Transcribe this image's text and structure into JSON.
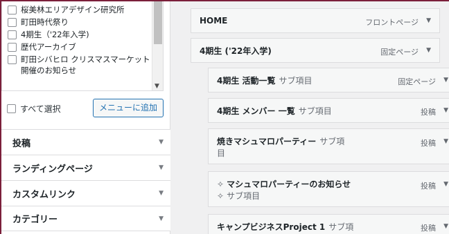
{
  "page_checklist": {
    "items": [
      "桜美林エリアデザイン研究所",
      "町田時代祭り",
      "4期生（'22年入学)",
      "歴代アーカイブ",
      "町田シバヒロ クリスマスマーケット開催のお知らせ"
    ],
    "select_all": "すべて選択",
    "add_to_menu": "メニューに追加"
  },
  "accordions": [
    "投稿",
    "ランディングページ",
    "カスタムリンク",
    "カテゴリー"
  ],
  "menu_items": [
    {
      "title": "HOME",
      "sub": "",
      "type": "フロントページ"
    },
    {
      "title": "4期生 ('22年入学)",
      "sub": "",
      "type": "固定ページ"
    },
    {
      "title": "4期生 活動一覧",
      "sub": "サブ項目",
      "type": "固定ページ"
    },
    {
      "title": "4期生 メンバー 一覧",
      "sub": "サブ項目",
      "type": "投稿"
    },
    {
      "title": "焼きマシュマロパーティー",
      "sub": "サブ項目",
      "type": "投稿"
    },
    {
      "title": "マシュマロパーティーのお知らせ",
      "sub": "サブ項目",
      "type": "投稿",
      "lead": "✧"
    },
    {
      "title": "キャンプビジネスProject 1",
      "sub": "サブ項",
      "type": "投稿"
    }
  ],
  "icons": {
    "dropdown": "▼",
    "checkbox": "checkbox-icon"
  },
  "colors": {
    "accent": "#2271b1",
    "frame": "#7b1f3a"
  }
}
